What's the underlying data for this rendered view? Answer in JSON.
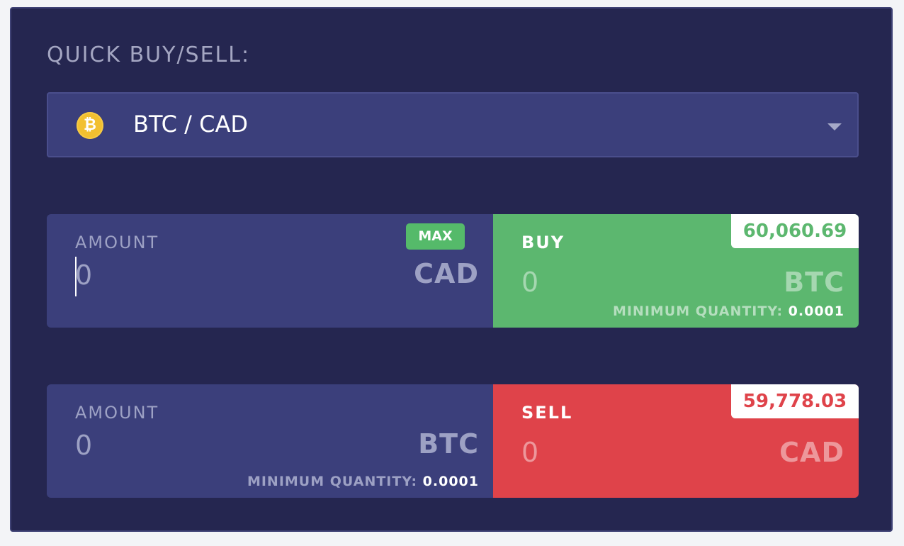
{
  "title": "QUICK BUY/SELL:",
  "pair_selector": {
    "icon": "bitcoin-icon",
    "icon_glyph": "₿",
    "label": "BTC / CAD"
  },
  "buy": {
    "amount_label": "AMOUNT",
    "amount_value": "0",
    "amount_currency": "CAD",
    "max_label": "MAX",
    "action_label": "BUY",
    "action_value": "0",
    "action_currency": "BTC",
    "price": "60,060.69",
    "min_qty_label": "MINIMUM QUANTITY:",
    "min_qty_value": "0.0001"
  },
  "sell": {
    "amount_label": "AMOUNT",
    "amount_value": "0",
    "amount_currency": "BTC",
    "min_qty_label": "MINIMUM QUANTITY:",
    "min_qty_value": "0.0001",
    "action_label": "SELL",
    "action_value": "0",
    "action_currency": "CAD",
    "price": "59,778.03"
  },
  "colors": {
    "panel_bg": "#252650",
    "field_bg": "#3b3f7b",
    "buy_green": "#5cb76f",
    "sell_red": "#df434a",
    "coin_gold": "#f2c030"
  }
}
